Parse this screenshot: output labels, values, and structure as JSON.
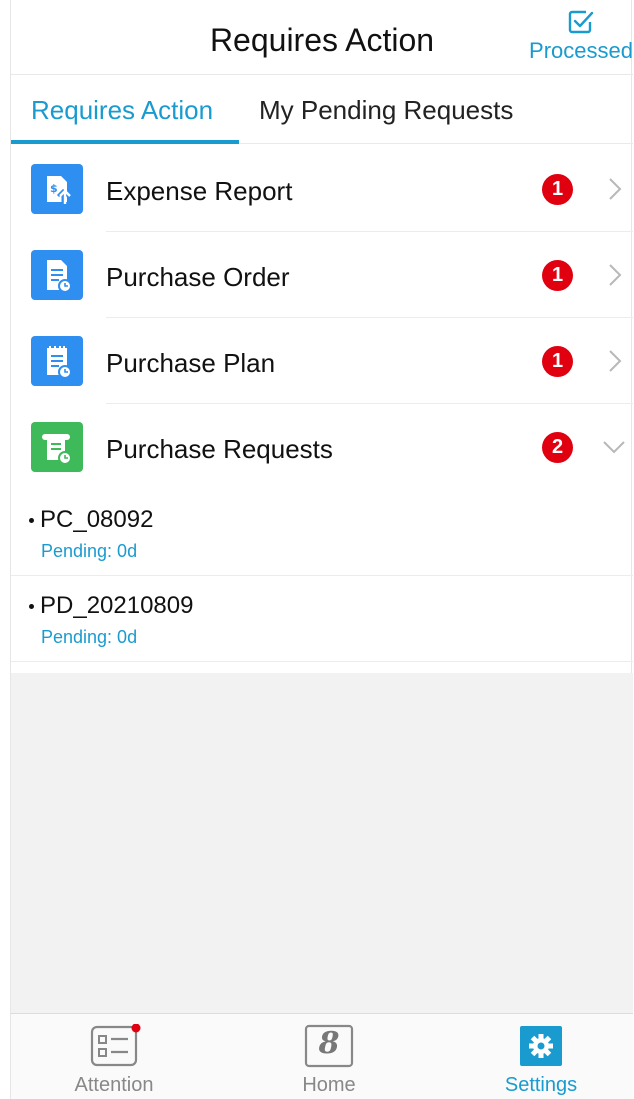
{
  "header": {
    "title": "Requires Action",
    "processed_label": "Processed",
    "processed_icon": "checkbox-edit-icon"
  },
  "tabs": [
    {
      "label": "Requires Action",
      "active": true
    },
    {
      "label": "My Pending Requests",
      "active": false
    }
  ],
  "items": [
    {
      "label": "Expense Report",
      "badge": "1",
      "icon": "expense-report-icon",
      "icon_color": "#2e8ff0",
      "expanded": false
    },
    {
      "label": "Purchase Order",
      "badge": "1",
      "icon": "purchase-order-icon",
      "icon_color": "#2e8ff0",
      "expanded": false
    },
    {
      "label": "Purchase Plan",
      "badge": "1",
      "icon": "purchase-plan-icon",
      "icon_color": "#2e8ff0",
      "expanded": false
    },
    {
      "label": "Purchase Requests",
      "badge": "2",
      "icon": "purchase-requests-icon",
      "icon_color": "#3fba5a",
      "expanded": true
    }
  ],
  "sub_items": [
    {
      "code": "PC_08092",
      "status": "Pending: 0d"
    },
    {
      "code": "PD_20210809",
      "status": "Pending: 0d"
    }
  ],
  "nav": [
    {
      "label": "Attention",
      "icon": "attention-list-icon",
      "active": false,
      "has_dot": true
    },
    {
      "label": "Home",
      "icon": "home-8-icon",
      "glyph": "8",
      "active": false
    },
    {
      "label": "Settings",
      "icon": "gear-icon",
      "active": true
    }
  ],
  "colors": {
    "accent": "#1a9bcf",
    "badge": "#e00010",
    "blue_icon": "#2e8ff0",
    "green_icon": "#3fba5a"
  }
}
